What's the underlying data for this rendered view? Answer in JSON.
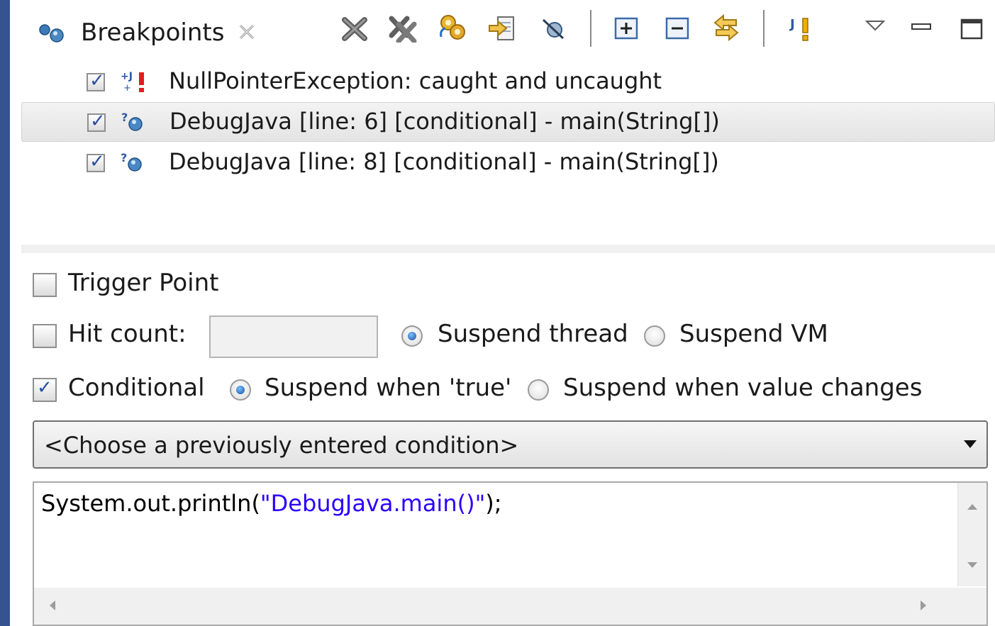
{
  "view": {
    "tab_label": "Breakpoints",
    "tab_icon": "breakpoints-view-icon",
    "close_icon": "close-x-icon"
  },
  "toolbar": [
    {
      "name": "remove-selected-breakpoints-button",
      "icon": "x-icon"
    },
    {
      "name": "remove-all-breakpoints-button",
      "icon": "double-x-icon"
    },
    {
      "name": "show-breakpoints-supported-by-target-button",
      "icon": "gears-icon"
    },
    {
      "name": "go-to-file-button",
      "icon": "go-to-file-icon"
    },
    {
      "name": "skip-all-breakpoints-button",
      "icon": "skip-breakpoints-icon"
    },
    {
      "name": "expand-all-button",
      "icon": "expand-all-icon"
    },
    {
      "name": "collapse-all-button",
      "icon": "collapse-all-icon"
    },
    {
      "name": "link-with-debug-view-button",
      "icon": "link-arrows-icon"
    },
    {
      "name": "add-java-exception-breakpoint-button",
      "icon": "exception-breakpoint-icon"
    },
    {
      "name": "view-menu-button",
      "icon": "triangle-down-icon"
    },
    {
      "name": "minimize-button",
      "icon": "minimize-icon"
    },
    {
      "name": "maximize-button",
      "icon": "maximize-icon"
    }
  ],
  "breakpoints": [
    {
      "label": "NullPointerException: caught and uncaught",
      "checked": true,
      "icon": "exception-breakpoint-icon",
      "selected": false
    },
    {
      "label": "DebugJava [line: 6] [conditional] - main(String[])",
      "checked": true,
      "icon": "conditional-breakpoint-icon",
      "selected": true
    },
    {
      "label": "DebugJava [line: 8] [conditional] - main(String[])",
      "checked": true,
      "icon": "conditional-breakpoint-icon",
      "selected": false
    }
  ],
  "detail": {
    "trigger_point": {
      "label": "Trigger Point",
      "checked": false
    },
    "hit_count": {
      "label": "Hit count:",
      "checked": false,
      "value": ""
    },
    "suspend_thread": {
      "label": "Suspend thread",
      "selected": true
    },
    "suspend_vm": {
      "label": "Suspend VM",
      "selected": false
    },
    "conditional": {
      "label": "Conditional",
      "checked": true
    },
    "suspend_when_true": {
      "label": "Suspend when 'true'",
      "selected": true
    },
    "suspend_when_changes": {
      "label": "Suspend when value changes",
      "selected": false
    },
    "condition_combo": {
      "value": "<Choose a previously entered condition>"
    },
    "condition_code": {
      "prefix": "System.out.println(",
      "string": "\"DebugJava.main()\"",
      "suffix": ");"
    }
  },
  "colors": {
    "accent_blue": "#2b4f9b",
    "string_literal": "#2a00ff",
    "side_strip": "#35548f"
  }
}
